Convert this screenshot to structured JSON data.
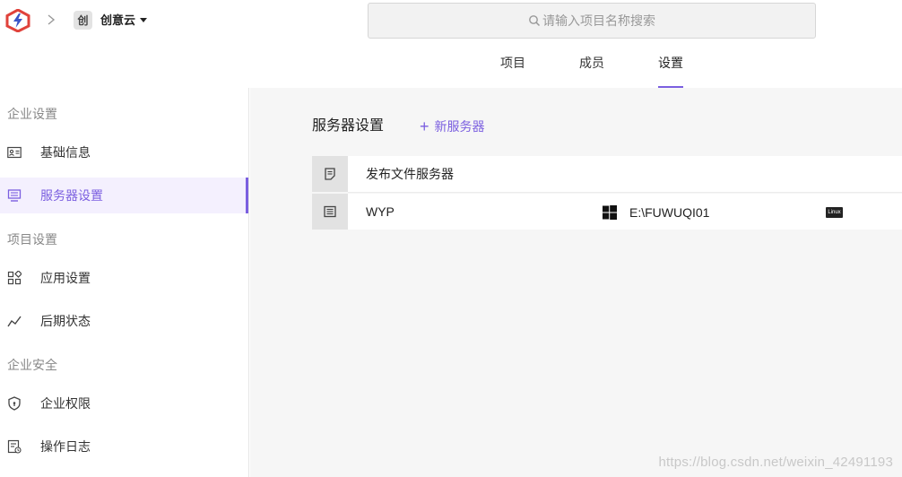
{
  "header": {
    "org_badge": "创",
    "org_name": "创意云",
    "search_placeholder": "请输入项目名称搜索"
  },
  "tabs": [
    {
      "label": "项目",
      "active": false
    },
    {
      "label": "成员",
      "active": false
    },
    {
      "label": "设置",
      "active": true
    }
  ],
  "sidebar": {
    "groups": [
      {
        "label": "企业设置"
      },
      {
        "label": "项目设置"
      },
      {
        "label": "企业安全"
      }
    ],
    "items": [
      {
        "label": "基础信息",
        "icon": "id-card-icon",
        "active": false
      },
      {
        "label": "服务器设置",
        "icon": "server-monitor-icon",
        "active": true
      },
      {
        "label": "应用设置",
        "icon": "apps-grid-icon",
        "active": false
      },
      {
        "label": "后期状态",
        "icon": "trend-line-icon",
        "active": false
      },
      {
        "label": "企业权限",
        "icon": "shield-icon",
        "active": false
      },
      {
        "label": "操作日志",
        "icon": "log-icon",
        "active": false
      }
    ]
  },
  "main": {
    "title": "服务器设置",
    "add_button": "新服务器",
    "rows": [
      {
        "name": "发布文件服务器",
        "icon": "document-icon"
      },
      {
        "name": "WYP",
        "icon": "server-list-icon",
        "os": "windows-icon",
        "path": "E:\\FUWUQI01",
        "badge": "Linux"
      }
    ]
  },
  "colors": {
    "accent": "#7b5fe0",
    "logo_red": "#e0423b",
    "logo_blue": "#3a55c8"
  },
  "watermark": "https://blog.csdn.net/weixin_42491193"
}
